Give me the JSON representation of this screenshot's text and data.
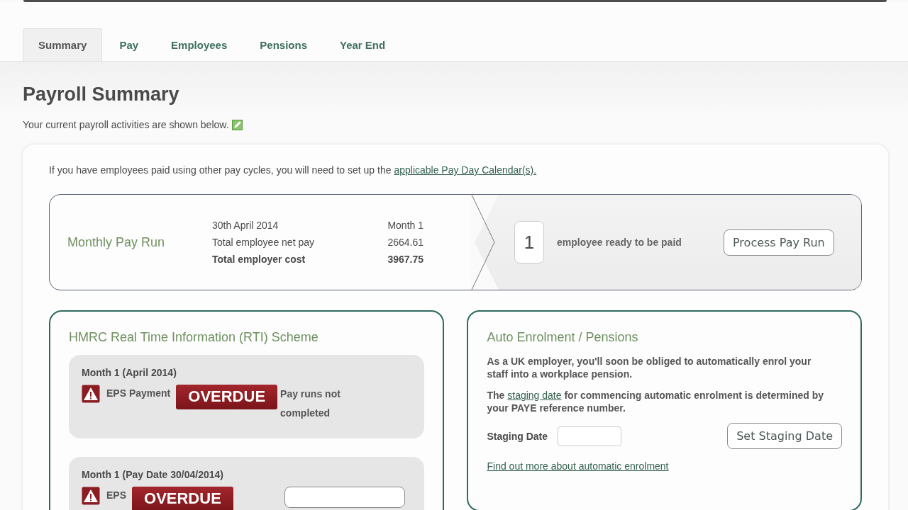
{
  "tabs": [
    {
      "label": "Summary",
      "selected": true
    },
    {
      "label": "Pay",
      "selected": false
    },
    {
      "label": "Employees",
      "selected": false
    },
    {
      "label": "Pensions",
      "selected": false
    },
    {
      "label": "Year End",
      "selected": false
    }
  ],
  "page": {
    "title": "Payroll Summary",
    "subtitle": "Your current payroll activities are shown below."
  },
  "notice": {
    "text": "If you have employees paid using other pay cycles, you will need to set up the ",
    "link": "applicable Pay Day Calendar(s)."
  },
  "pay_run": {
    "title": "Monthly Pay Run",
    "rows": [
      {
        "label": "30th April 2014",
        "value": "Month 1",
        "bold": false
      },
      {
        "label": "Total employee net pay",
        "value": "2664.61",
        "bold": false
      },
      {
        "label": "Total employer cost",
        "value": "3967.75",
        "bold": true
      }
    ],
    "count": "1",
    "count_text": "employee ready to be paid",
    "button": "Process Pay Run"
  },
  "rti": {
    "title": "HMRC Real Time Information (RTI) Scheme",
    "items": [
      {
        "heading": "Month 1 (April 2014)",
        "label": "EPS Payment",
        "badge": "OVERDUE",
        "note": "Pay runs not completed"
      },
      {
        "heading": "Month 1 (Pay Date 30/04/2014)",
        "label": "EPS",
        "badge": "OVERDUE",
        "has_button": true
      }
    ]
  },
  "pensions": {
    "title": "Auto Enrolment / Pensions",
    "paragraph_1": "As a UK employer, you'll soon be obliged to automatically enrol your staff into a workplace pension.",
    "paragraph_2_before": "The ",
    "paragraph_2_link": "staging date",
    "paragraph_2_after": " for commencing automatic enrolment is determined by your PAYE reference number.",
    "field_label": "Staging Date",
    "button": "Set Staging Date",
    "link": "Find out more about automatic enrolment"
  }
}
